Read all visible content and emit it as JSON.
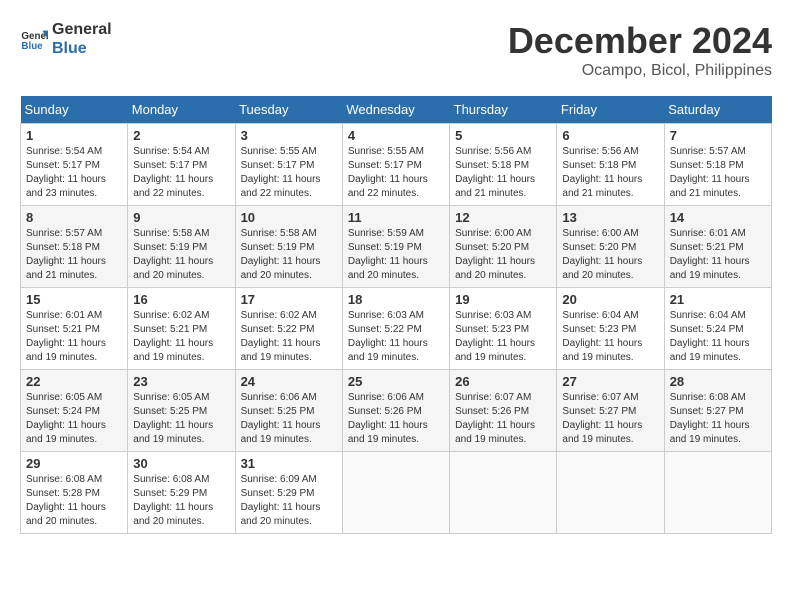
{
  "header": {
    "logo_line1": "General",
    "logo_line2": "Blue",
    "month": "December 2024",
    "location": "Ocampo, Bicol, Philippines"
  },
  "weekdays": [
    "Sunday",
    "Monday",
    "Tuesday",
    "Wednesday",
    "Thursday",
    "Friday",
    "Saturday"
  ],
  "weeks": [
    [
      {
        "day": "1",
        "sunrise": "5:54 AM",
        "sunset": "5:17 PM",
        "daylight": "11 hours and 23 minutes."
      },
      {
        "day": "2",
        "sunrise": "5:54 AM",
        "sunset": "5:17 PM",
        "daylight": "11 hours and 22 minutes."
      },
      {
        "day": "3",
        "sunrise": "5:55 AM",
        "sunset": "5:17 PM",
        "daylight": "11 hours and 22 minutes."
      },
      {
        "day": "4",
        "sunrise": "5:55 AM",
        "sunset": "5:17 PM",
        "daylight": "11 hours and 22 minutes."
      },
      {
        "day": "5",
        "sunrise": "5:56 AM",
        "sunset": "5:18 PM",
        "daylight": "11 hours and 21 minutes."
      },
      {
        "day": "6",
        "sunrise": "5:56 AM",
        "sunset": "5:18 PM",
        "daylight": "11 hours and 21 minutes."
      },
      {
        "day": "7",
        "sunrise": "5:57 AM",
        "sunset": "5:18 PM",
        "daylight": "11 hours and 21 minutes."
      }
    ],
    [
      {
        "day": "8",
        "sunrise": "5:57 AM",
        "sunset": "5:18 PM",
        "daylight": "11 hours and 21 minutes."
      },
      {
        "day": "9",
        "sunrise": "5:58 AM",
        "sunset": "5:19 PM",
        "daylight": "11 hours and 20 minutes."
      },
      {
        "day": "10",
        "sunrise": "5:58 AM",
        "sunset": "5:19 PM",
        "daylight": "11 hours and 20 minutes."
      },
      {
        "day": "11",
        "sunrise": "5:59 AM",
        "sunset": "5:19 PM",
        "daylight": "11 hours and 20 minutes."
      },
      {
        "day": "12",
        "sunrise": "6:00 AM",
        "sunset": "5:20 PM",
        "daylight": "11 hours and 20 minutes."
      },
      {
        "day": "13",
        "sunrise": "6:00 AM",
        "sunset": "5:20 PM",
        "daylight": "11 hours and 20 minutes."
      },
      {
        "day": "14",
        "sunrise": "6:01 AM",
        "sunset": "5:21 PM",
        "daylight": "11 hours and 19 minutes."
      }
    ],
    [
      {
        "day": "15",
        "sunrise": "6:01 AM",
        "sunset": "5:21 PM",
        "daylight": "11 hours and 19 minutes."
      },
      {
        "day": "16",
        "sunrise": "6:02 AM",
        "sunset": "5:21 PM",
        "daylight": "11 hours and 19 minutes."
      },
      {
        "day": "17",
        "sunrise": "6:02 AM",
        "sunset": "5:22 PM",
        "daylight": "11 hours and 19 minutes."
      },
      {
        "day": "18",
        "sunrise": "6:03 AM",
        "sunset": "5:22 PM",
        "daylight": "11 hours and 19 minutes."
      },
      {
        "day": "19",
        "sunrise": "6:03 AM",
        "sunset": "5:23 PM",
        "daylight": "11 hours and 19 minutes."
      },
      {
        "day": "20",
        "sunrise": "6:04 AM",
        "sunset": "5:23 PM",
        "daylight": "11 hours and 19 minutes."
      },
      {
        "day": "21",
        "sunrise": "6:04 AM",
        "sunset": "5:24 PM",
        "daylight": "11 hours and 19 minutes."
      }
    ],
    [
      {
        "day": "22",
        "sunrise": "6:05 AM",
        "sunset": "5:24 PM",
        "daylight": "11 hours and 19 minutes."
      },
      {
        "day": "23",
        "sunrise": "6:05 AM",
        "sunset": "5:25 PM",
        "daylight": "11 hours and 19 minutes."
      },
      {
        "day": "24",
        "sunrise": "6:06 AM",
        "sunset": "5:25 PM",
        "daylight": "11 hours and 19 minutes."
      },
      {
        "day": "25",
        "sunrise": "6:06 AM",
        "sunset": "5:26 PM",
        "daylight": "11 hours and 19 minutes."
      },
      {
        "day": "26",
        "sunrise": "6:07 AM",
        "sunset": "5:26 PM",
        "daylight": "11 hours and 19 minutes."
      },
      {
        "day": "27",
        "sunrise": "6:07 AM",
        "sunset": "5:27 PM",
        "daylight": "11 hours and 19 minutes."
      },
      {
        "day": "28",
        "sunrise": "6:08 AM",
        "sunset": "5:27 PM",
        "daylight": "11 hours and 19 minutes."
      }
    ],
    [
      {
        "day": "29",
        "sunrise": "6:08 AM",
        "sunset": "5:28 PM",
        "daylight": "11 hours and 20 minutes."
      },
      {
        "day": "30",
        "sunrise": "6:08 AM",
        "sunset": "5:29 PM",
        "daylight": "11 hours and 20 minutes."
      },
      {
        "day": "31",
        "sunrise": "6:09 AM",
        "sunset": "5:29 PM",
        "daylight": "11 hours and 20 minutes."
      },
      null,
      null,
      null,
      null
    ]
  ]
}
